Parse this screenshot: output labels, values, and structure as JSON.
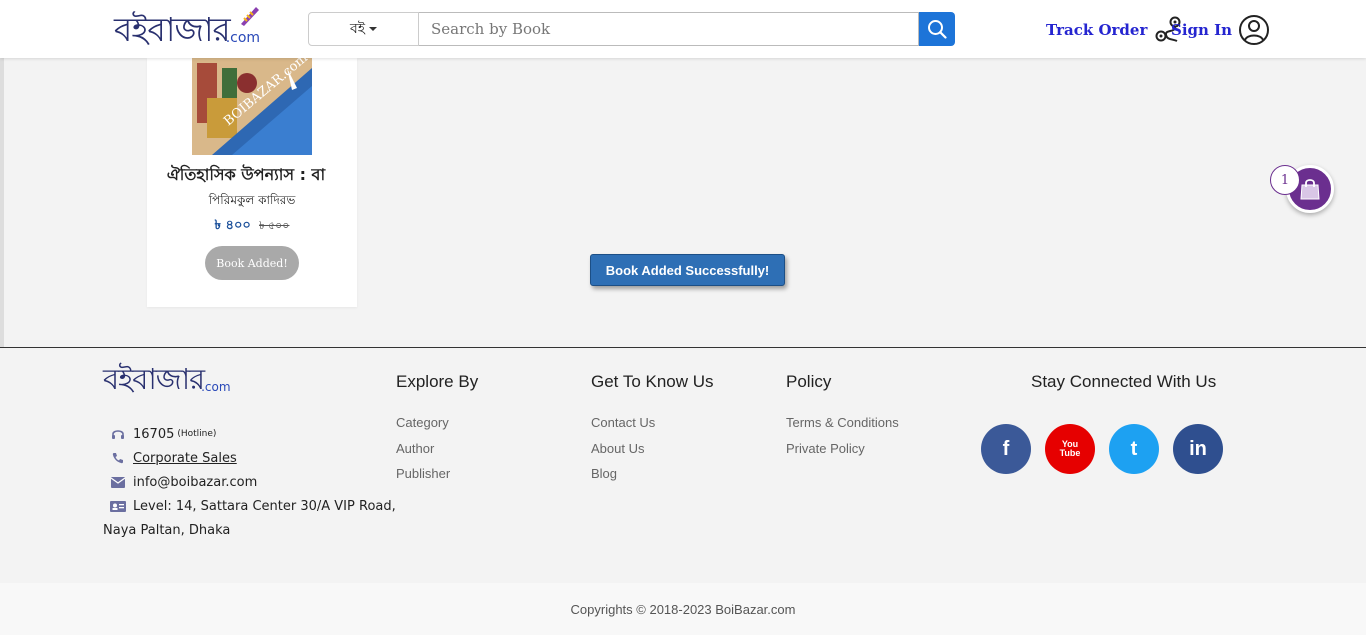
{
  "header": {
    "logo_text": "বইবাজার",
    "logo_suffix": ".com",
    "category_select": "বই",
    "search_placeholder": "Search by Book",
    "track_order": "Track Order",
    "sign_in": "Sign In"
  },
  "book": {
    "cover_watermark": "BOIBAZAR.com",
    "title": "ঐতিহাসিক উপন্যাস : বা",
    "author": "পিরিমকুল কাদিরভ",
    "price_current": "৳ ৪০০",
    "price_original": "৳ ৫০০",
    "button_label": "Book Added!"
  },
  "toast": "Book Added Successfully!",
  "cart": {
    "count": "1"
  },
  "footer": {
    "logo_text": "বইবাজার",
    "logo_suffix": ".com",
    "hotline": "16705",
    "hotline_label": "(Hotline)",
    "corporate_sales": "Corporate Sales",
    "email": "info@boibazar.com",
    "address_line1": "Level: 14, Sattara Center 30/A VIP Road,",
    "address_line2": "Naya Paltan, Dhaka",
    "explore": {
      "heading": "Explore By",
      "links": [
        "Category",
        "Author",
        "Publisher"
      ]
    },
    "know": {
      "heading": "Get To Know Us",
      "links": [
        "Contact Us",
        "About Us",
        "Blog"
      ]
    },
    "policy": {
      "heading": "Policy",
      "links": [
        "Terms & Conditions",
        "Private Policy"
      ]
    },
    "social": {
      "heading": "Stay Connected With Us",
      "items": [
        {
          "name": "facebook",
          "glyph": "f",
          "color": "#3b5998"
        },
        {
          "name": "youtube",
          "glyph": "You Tube",
          "color": "#e60000"
        },
        {
          "name": "twitter",
          "glyph": "t",
          "color": "#1da1f2"
        },
        {
          "name": "linkedin",
          "glyph": "in",
          "color": "#2f4f8f"
        }
      ]
    },
    "copyright": "Copyrights © 2018-2023 BoiBazar.com"
  },
  "icons": [
    "search-icon",
    "route-icon",
    "user-circle-icon",
    "shopping-bag-icon",
    "headset-icon",
    "phone-icon",
    "envelope-icon",
    "id-card-icon",
    "facebook-icon",
    "youtube-icon",
    "twitter-icon",
    "linkedin-icon"
  ]
}
